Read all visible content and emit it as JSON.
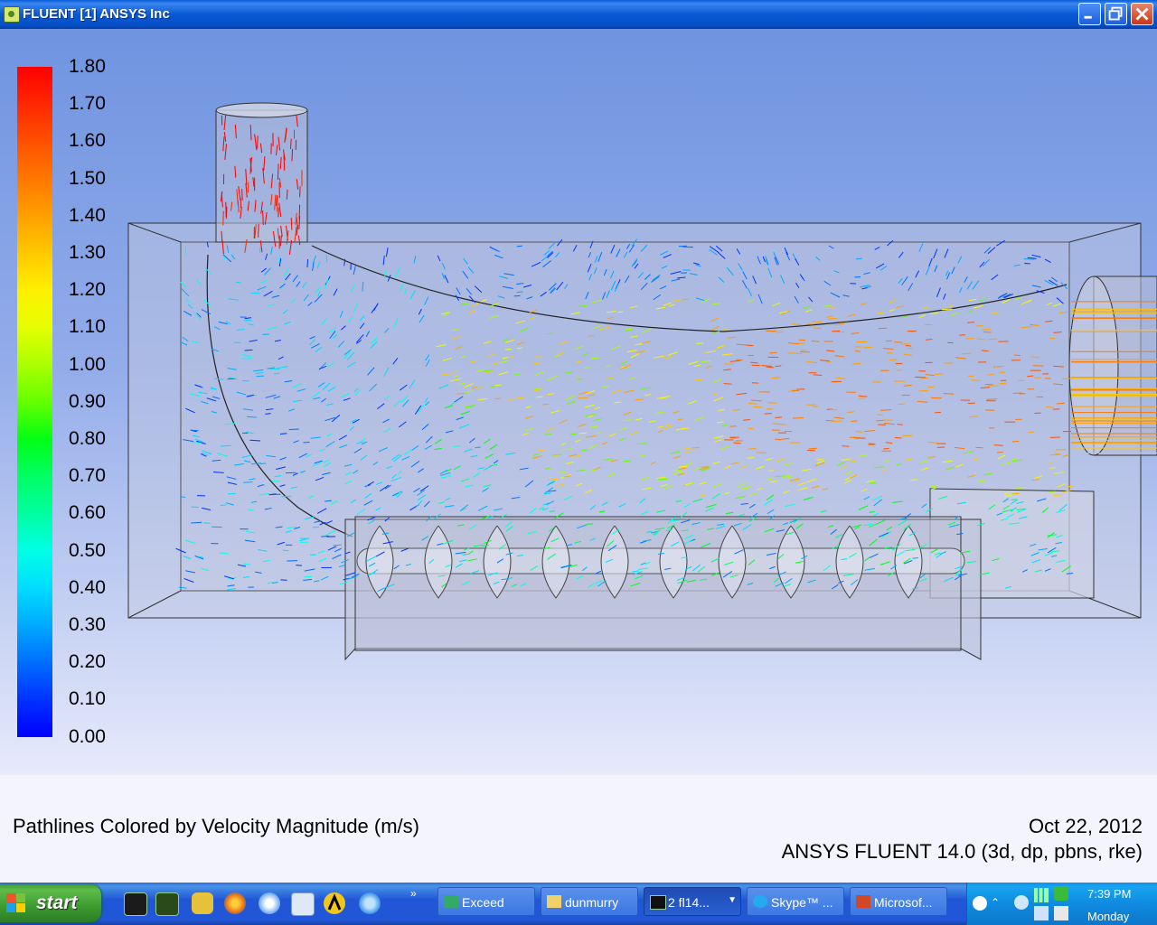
{
  "window": {
    "title": "FLUENT [1] ANSYS Inc"
  },
  "legend": {
    "labels": [
      "1.80",
      "1.70",
      "1.60",
      "1.50",
      "1.40",
      "1.30",
      "1.20",
      "1.10",
      "1.00",
      "0.90",
      "0.80",
      "0.70",
      "0.60",
      "0.50",
      "0.40",
      "0.30",
      "0.20",
      "0.10",
      "0.00"
    ],
    "colors": [
      "#ff0000",
      "#ff2800",
      "#ff5000",
      "#ff7800",
      "#ffa000",
      "#ffc800",
      "#fff000",
      "#e6ff00",
      "#aaff00",
      "#64ff00",
      "#00ff14",
      "#00ff64",
      "#00ffa0",
      "#00ffe6",
      "#00dcff",
      "#00aaff",
      "#006eff",
      "#0032ff",
      "#0000ff"
    ]
  },
  "caption": {
    "description": "Pathlines Colored by Velocity Magnitude (m/s)",
    "date": "Oct 22, 2012",
    "version": "ANSYS FLUENT 14.0 (3d, dp, pbns, rke)"
  },
  "taskbar": {
    "start_label": "start",
    "quick_launch": [
      "exceed-icon",
      "gambit-icon",
      "folder-icon",
      "firefox-icon",
      "outlook-icon",
      "notepad-icon",
      "autodesk-icon",
      "internet-explorer-icon"
    ],
    "more": "»",
    "tasks": [
      {
        "label": "Exceed",
        "icon": "exceed-icon"
      },
      {
        "label": "dunmurry",
        "icon": "folder-icon"
      },
      {
        "label": "2 fl14...",
        "icon": "fluent-icon"
      },
      {
        "label": "Skype™ ...",
        "icon": "skype-icon"
      },
      {
        "label": "Microsof...",
        "icon": "powerpoint-icon"
      }
    ],
    "clock": "7:39 PM",
    "day": "Monday"
  }
}
